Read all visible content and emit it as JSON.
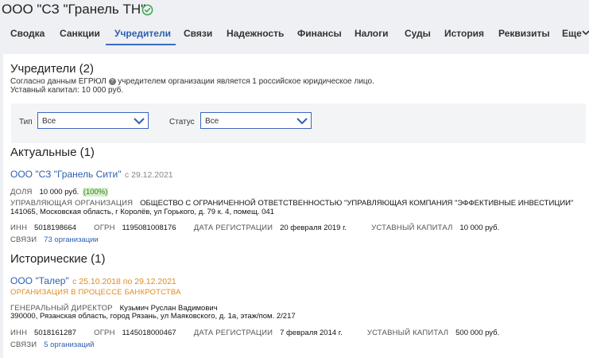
{
  "header": {
    "company_title": "ООО \"СЗ \"Гранель ТН\""
  },
  "tabs": [
    {
      "label": "Сводка"
    },
    {
      "label": "Санкции"
    },
    {
      "label": "Учредители"
    },
    {
      "label": "Связи"
    },
    {
      "label": "Надежность"
    },
    {
      "label": "Финансы"
    },
    {
      "label": "Налоги"
    },
    {
      "label": "Суды"
    },
    {
      "label": "История"
    },
    {
      "label": "Реквизиты"
    },
    {
      "label": "Еще"
    }
  ],
  "founders": {
    "title": "Учредители (2)",
    "desc_prefix": "Согласно данным ЕГРЮЛ",
    "desc_suffix": "учредителем организации является 1 российское юридическое лицо.",
    "capital": "Уставный капитал: 10 000 руб."
  },
  "filters": {
    "type_label": "Тип",
    "type_value": "Все",
    "status_label": "Статус",
    "status_value": "Все"
  },
  "actual": {
    "title": "Актуальные (1)",
    "name": "ООО \"СЗ \"Гранель Сити\"",
    "since": "с 29.12.2021",
    "share_label": "ДОЛЯ",
    "share_value": "10 000 руб.",
    "share_pct": "(100%)",
    "mgmt_label": "УПРАВЛЯЮЩАЯ ОРГАНИЗАЦИЯ",
    "mgmt_value": "ОБЩЕСТВО С ОГРАНИЧЕННОЙ ОТВЕТСТВЕННОСТЬЮ \"УПРАВЛЯЮЩАЯ КОМПАНИЯ \"ЭФФЕКТИВНЫЕ ИНВЕСТИЦИИ\"",
    "address": "141065, Московская область, г Королёв, ул Горького, д. 79 к. 4, помещ. 041",
    "inn_label": "ИНН",
    "inn": "5018198664",
    "ogrn_label": "ОГРН",
    "ogrn": "1195081008176",
    "reg_label": "ДАТА РЕГИСТРАЦИИ",
    "reg": "20 февраля 2019 г.",
    "cap_label": "УСТАВНЫЙ КАПИТАЛ",
    "cap": "10 000 руб.",
    "links_label": "СВЯЗИ",
    "links": "73 организации"
  },
  "historic": {
    "title": "Исторические (1)",
    "name": "ООО \"Талер\"",
    "period": "с 25.10.2018 по 29.12.2021",
    "status": "ОРГАНИЗАЦИЯ В ПРОЦЕССЕ БАНКРОТСТВА",
    "director_label": "ГЕНЕРАЛЬНЫЙ ДИРЕКТОР",
    "director": "Кузьмич Руслан Вадимович",
    "address": "390000, Рязанская область, город Рязань, ул Маяковского, д. 1а, этаж/пом. 2/217",
    "inn_label": "ИНН",
    "inn": "5018161287",
    "ogrn_label": "ОГРН",
    "ogrn": "1145018000467",
    "reg_label": "ДАТА РЕГИСТРАЦИИ",
    "reg": "7 февраля 2014 г.",
    "cap_label": "УСТАВНЫЙ КАПИТАЛ",
    "cap": "500 000 руб.",
    "links_label": "СВЯЗИ",
    "links": "5 организаций"
  },
  "colors": {
    "accent": "#2d5fb0",
    "verified": "#3aa64a",
    "orange": "#e08a1e",
    "share_bg": "#d6f0c9"
  }
}
